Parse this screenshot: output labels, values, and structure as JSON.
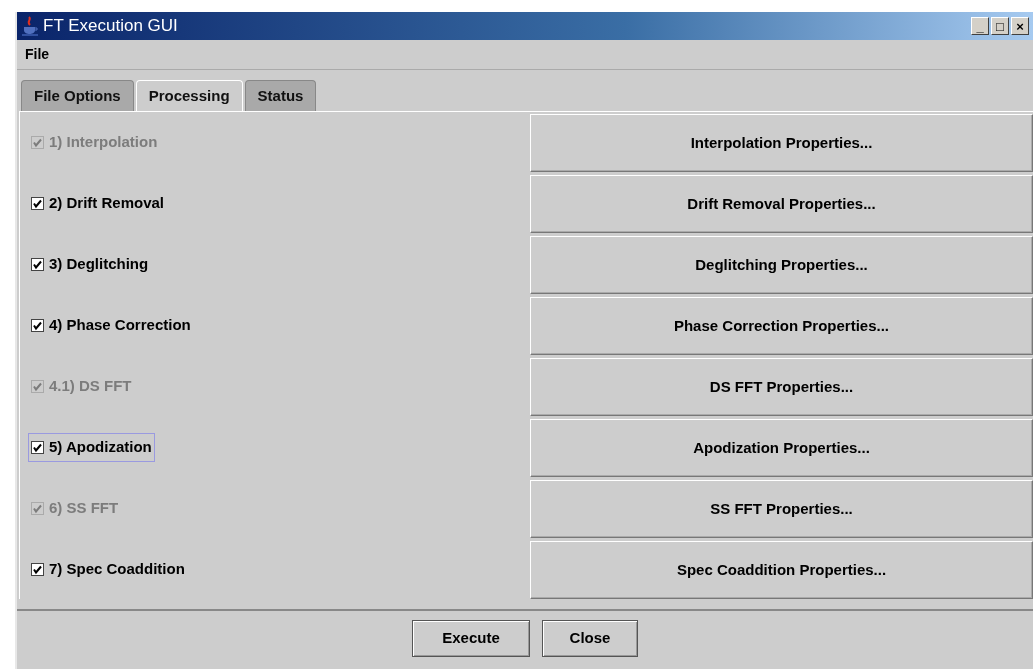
{
  "window": {
    "title": "FT Execution GUI",
    "controls": [
      "_",
      "□",
      "×"
    ]
  },
  "menu": [
    "File"
  ],
  "tabs": [
    {
      "label": "File Options",
      "selected": false
    },
    {
      "label": "Processing",
      "selected": true
    },
    {
      "label": "Status",
      "selected": false
    }
  ],
  "steps": [
    {
      "label": "1) Interpolation",
      "checked": true,
      "disabled": true,
      "focused": false,
      "button": "Interpolation Properties..."
    },
    {
      "label": "2) Drift Removal",
      "checked": true,
      "disabled": false,
      "focused": false,
      "button": "Drift Removal Properties..."
    },
    {
      "label": "3) Deglitching",
      "checked": true,
      "disabled": false,
      "focused": false,
      "button": "Deglitching Properties..."
    },
    {
      "label": "4) Phase Correction",
      "checked": true,
      "disabled": false,
      "focused": false,
      "button": "Phase Correction Properties..."
    },
    {
      "label": "4.1) DS FFT",
      "checked": true,
      "disabled": true,
      "focused": false,
      "button": "DS FFT Properties..."
    },
    {
      "label": "5) Apodization",
      "checked": true,
      "disabled": false,
      "focused": true,
      "button": "Apodization Properties..."
    },
    {
      "label": "6) SS FFT",
      "checked": true,
      "disabled": true,
      "focused": false,
      "button": "SS FFT Properties..."
    },
    {
      "label": "7) Spec Coaddition",
      "checked": true,
      "disabled": false,
      "focused": false,
      "button": "Spec Coaddition Properties..."
    }
  ],
  "buttons": [
    "Execute",
    "Close"
  ]
}
